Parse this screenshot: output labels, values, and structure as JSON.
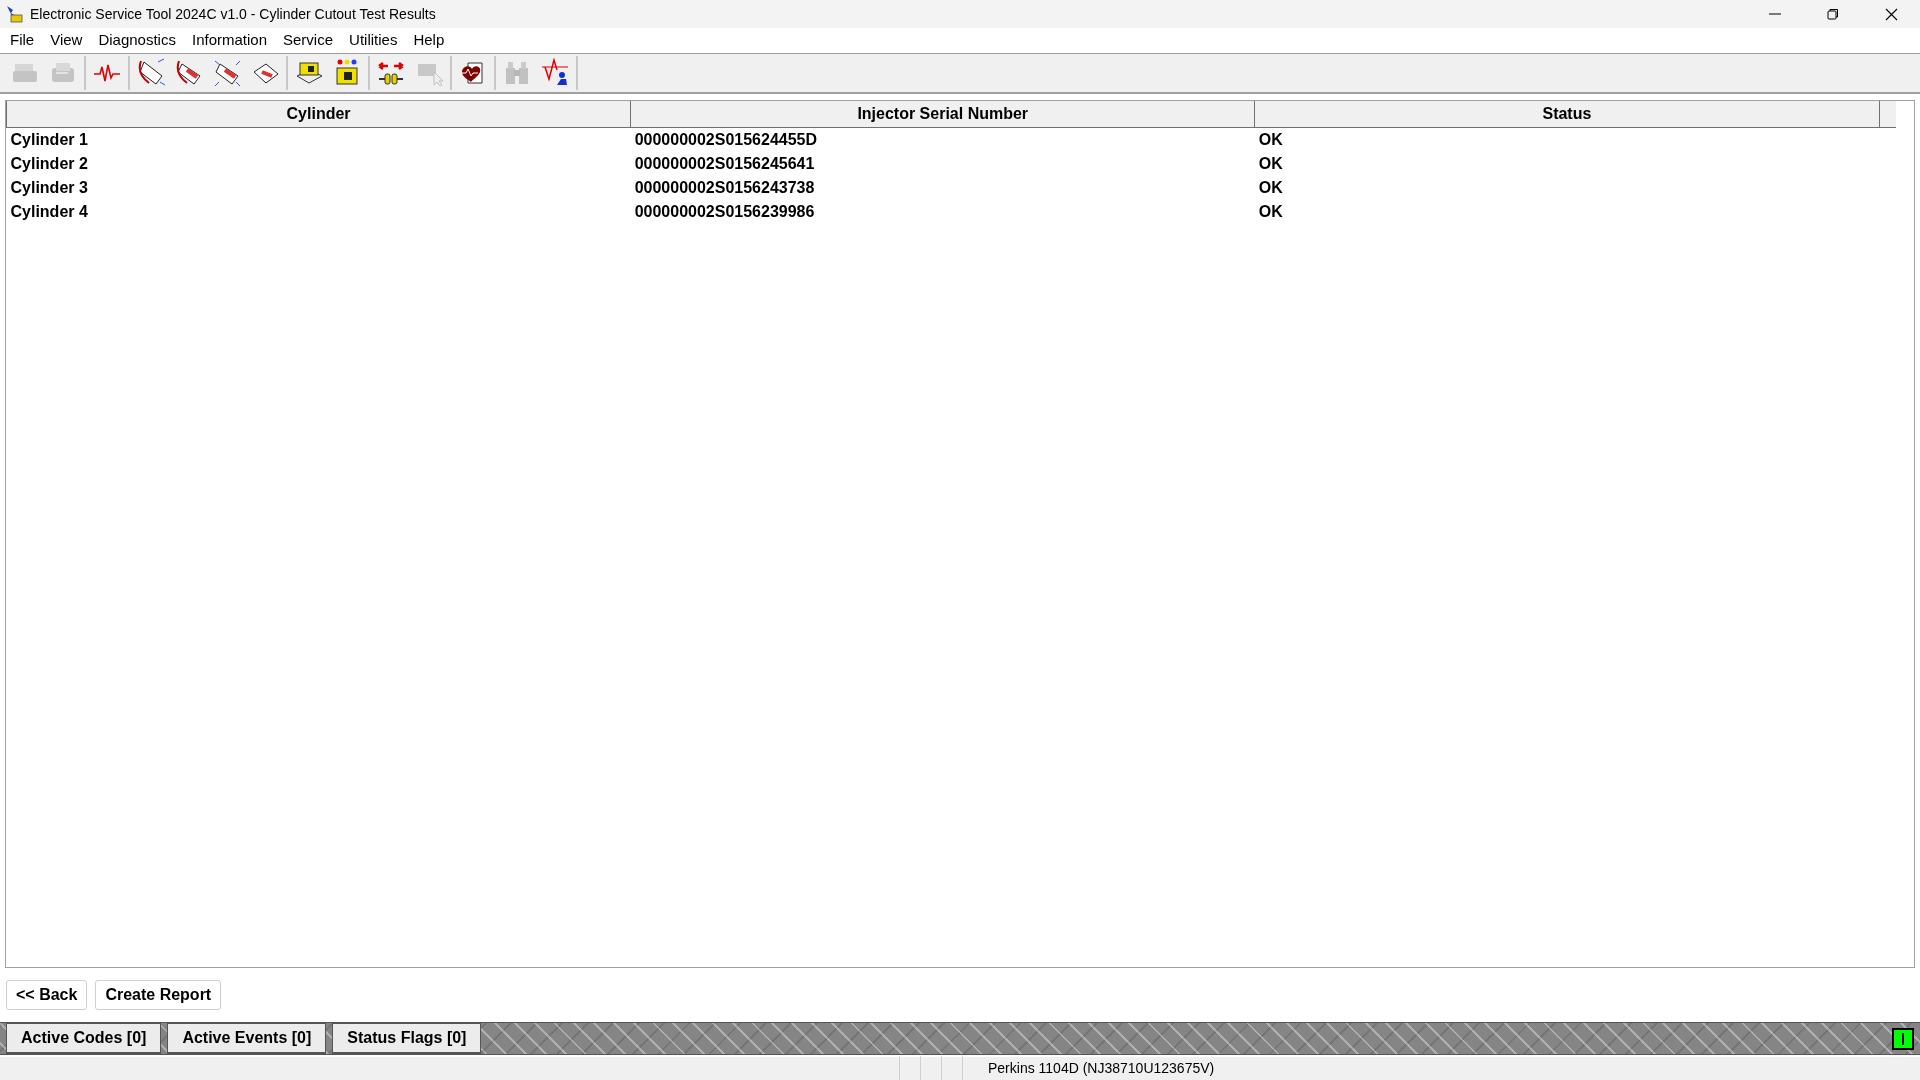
{
  "window": {
    "title": "Electronic Service Tool 2024C v1.0 - Cylinder Cutout Test Results"
  },
  "menu": [
    "File",
    "View",
    "Diagnostics",
    "Information",
    "Service",
    "Utilities",
    "Help"
  ],
  "toolbar": [
    [
      {
        "kind": "printer",
        "disabled": true
      },
      {
        "kind": "fax",
        "disabled": true
      }
    ],
    [
      {
        "kind": "waveform",
        "disabled": false
      }
    ],
    [
      {
        "kind": "stethoscope",
        "disabled": false
      },
      {
        "kind": "stethoscope-pen",
        "disabled": false
      },
      {
        "kind": "document-sparkle",
        "disabled": false
      },
      {
        "kind": "document-pen",
        "disabled": false
      }
    ],
    [
      {
        "kind": "module-stack",
        "disabled": false
      },
      {
        "kind": "module-pins",
        "disabled": false
      }
    ],
    [
      {
        "kind": "connector-arrows",
        "disabled": false
      },
      {
        "kind": "module-cursor",
        "disabled": true
      }
    ],
    [
      {
        "kind": "heart-document",
        "disabled": false
      }
    ],
    [
      {
        "kind": "binoculars",
        "disabled": true
      },
      {
        "kind": "graph-person",
        "disabled": false
      }
    ]
  ],
  "table": {
    "columns": [
      "Cylinder",
      "Injector Serial Number",
      "Status"
    ],
    "rows": [
      [
        "Cylinder 1",
        "000000002S015624455D",
        "OK"
      ],
      [
        "Cylinder 2",
        "000000002S0156245641",
        "OK"
      ],
      [
        "Cylinder 3",
        "000000002S0156243738",
        "OK"
      ],
      [
        "Cylinder 4",
        "000000002S0156239986",
        "OK"
      ]
    ]
  },
  "buttons": [
    "<< Back",
    "Create Report"
  ],
  "indicator_tabs": [
    "Active Codes [0]",
    "Active Events [0]",
    "Status Flags [0]"
  ],
  "status_bar": {
    "panes": [
      "Perkins 1104D (NJ38710U123675V)"
    ]
  }
}
